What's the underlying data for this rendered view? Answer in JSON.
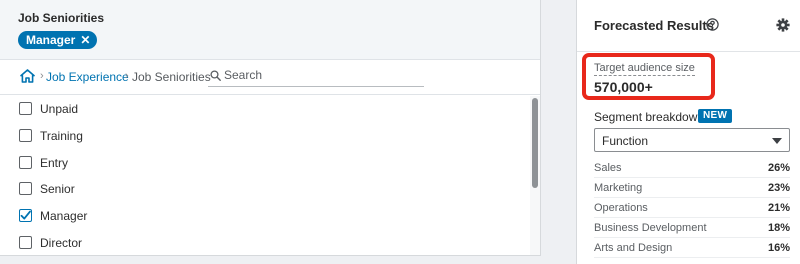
{
  "seniority": {
    "title": "Job Seniorities",
    "selected_pill": "Manager",
    "pill_remove": "✕"
  },
  "breadcrumb": {
    "separator": "›",
    "items": [
      "Job Experience",
      "Job Seniorities"
    ]
  },
  "search": {
    "value": "",
    "placeholder": "Search"
  },
  "options": [
    {
      "label": "Unpaid",
      "checked": false
    },
    {
      "label": "Training",
      "checked": false
    },
    {
      "label": "Entry",
      "checked": false
    },
    {
      "label": "Senior",
      "checked": false
    },
    {
      "label": "Manager",
      "checked": true
    },
    {
      "label": "Director",
      "checked": false
    }
  ],
  "forecast": {
    "title": "Forecasted Results",
    "audience_label": "Target audience size",
    "audience_value": "570,000+",
    "segment_label": "Segment breakdown",
    "new_badge": "NEW",
    "dropdown_value": "Function",
    "breakdown": [
      {
        "name": "Sales",
        "pct": "26%"
      },
      {
        "name": "Marketing",
        "pct": "23%"
      },
      {
        "name": "Operations",
        "pct": "21%"
      },
      {
        "name": "Business Development",
        "pct": "18%"
      },
      {
        "name": "Arts and Design",
        "pct": "16%"
      }
    ]
  },
  "colors": {
    "accent": "#0073b1",
    "highlight": "#e8281b",
    "panel_header_bg": "#f3f6f8",
    "page_bg": "#eef0f3"
  },
  "icons": {
    "home": "home-icon",
    "search": "search-icon",
    "help": "help-circle-icon",
    "settings": "gear-icon",
    "dropdown": "chevron-down-icon",
    "check": "checkmark-icon"
  }
}
